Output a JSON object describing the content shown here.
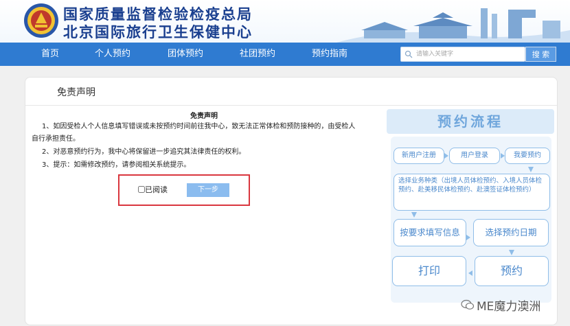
{
  "header": {
    "title": "国家质量监督检验检疫总局",
    "subtitle": "北京国际旅行卫生保健中心"
  },
  "nav": {
    "items": [
      "首页",
      "个人预约",
      "团体预约",
      "社团预约",
      "预约指南"
    ]
  },
  "search": {
    "placeholder": "请输入关键字",
    "button_label": "搜 索"
  },
  "panel": {
    "title": "免责声明",
    "heading": "免责声明",
    "paragraphs": [
      "1、如因受检人个人信息填写错误或未按预约时间前往我中心，致无法正常体检和预防接种的，由受检人",
      "自行承担责任。",
      "2、对恶意预约行为，我中心将保留进一步追究其法律责任的权利。",
      "3、提示：如需修改预约，请参阅相关系统提示。"
    ],
    "checkbox_label": "已阅读",
    "next_label": "下一步"
  },
  "flow": {
    "title": "预约流程",
    "steps": [
      "新用户注册",
      "用户登录",
      "我要预约"
    ],
    "category": "选择业务种类（出境人员体检预约、入境人员体检预约、赴美移民体检预约、赴澳签证体检预约）",
    "fill_info": "按要求填写信息",
    "choose_date": "选择预约日期",
    "print": "打印",
    "reserve": "预约"
  },
  "watermark": {
    "text": "ME魔力澳洲"
  },
  "colors": {
    "nav_bg": "#2f7bd1",
    "title_blue": "#1a3f8f",
    "highlight_red": "#d9363e",
    "flow_blue": "#4a88cc"
  }
}
